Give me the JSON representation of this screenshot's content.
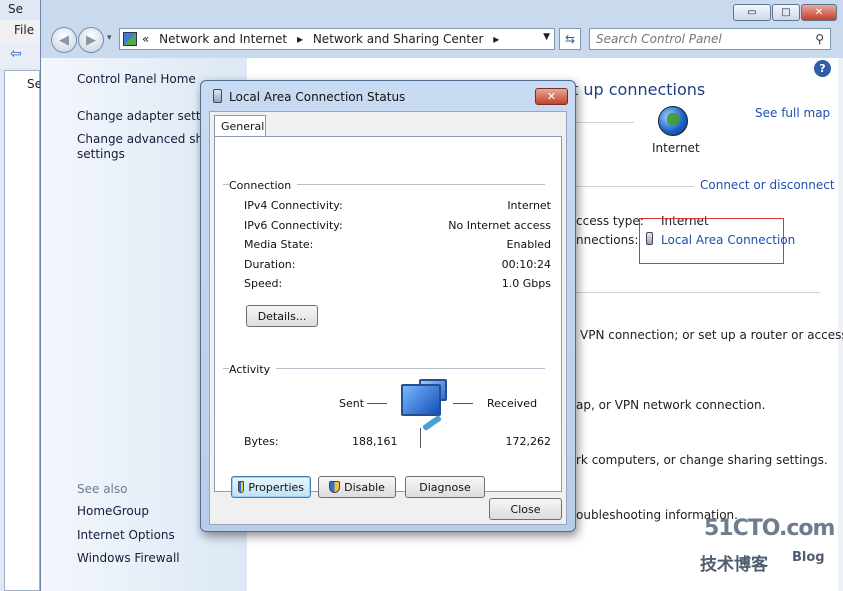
{
  "bg_window": {
    "title": "Se",
    "menu_file": "File",
    "pane_label": "Se"
  },
  "window": {
    "caption": {
      "minimize": "▭",
      "maximize": "□",
      "close": "✕"
    },
    "breadcrumb": {
      "prefix": "«",
      "items": [
        "Network and Internet",
        "Network and Sharing Center"
      ]
    },
    "search_placeholder": "Search Control Panel"
  },
  "sidebar": {
    "home": "Control Panel Home",
    "change_adapter": "Change adapter settings",
    "change_advanced_1": "Change advanced sharing",
    "change_advanced_2": "settings",
    "see_also": "See also",
    "homegroup": "HomeGroup",
    "internet_options": "Internet Options",
    "windows_firewall": "Windows Firewall"
  },
  "content": {
    "heading": "t up connections",
    "see_full_map": "See full map",
    "internet_label": "Internet",
    "connect_disconnect": "Connect or disconnect",
    "access_type_label": "ccess type:",
    "access_type_value": "Internet",
    "connections_label": "nnections:",
    "connection_link": "Local Area Connection",
    "line1": "VPN connection; or set up a router or access",
    "line2": "ap, or VPN network connection.",
    "line3": "rk computers, or change sharing settings.",
    "line4": "oubleshooting information."
  },
  "dialog": {
    "title": "Local Area Connection Status",
    "tab": "General",
    "connection_group": "Connection",
    "rows": [
      {
        "label": "IPv4 Connectivity:",
        "value": "Internet"
      },
      {
        "label": "IPv6 Connectivity:",
        "value": "No Internet access"
      },
      {
        "label": "Media State:",
        "value": "Enabled"
      },
      {
        "label": "Duration:",
        "value": "00:10:24"
      },
      {
        "label": "Speed:",
        "value": "1.0 Gbps"
      }
    ],
    "details_button": "Details...",
    "activity_group": "Activity",
    "sent_label": "Sent",
    "received_label": "Received",
    "bytes_label": "Bytes:",
    "bytes_sent": "188,161",
    "bytes_received": "172,262",
    "properties_button": "Properties",
    "disable_button": "Disable",
    "diagnose_button": "Diagnose",
    "close_button": "Close"
  },
  "watermark": {
    "brand": "51CTO.com",
    "cn": "技术博客",
    "blog": "Blog"
  }
}
